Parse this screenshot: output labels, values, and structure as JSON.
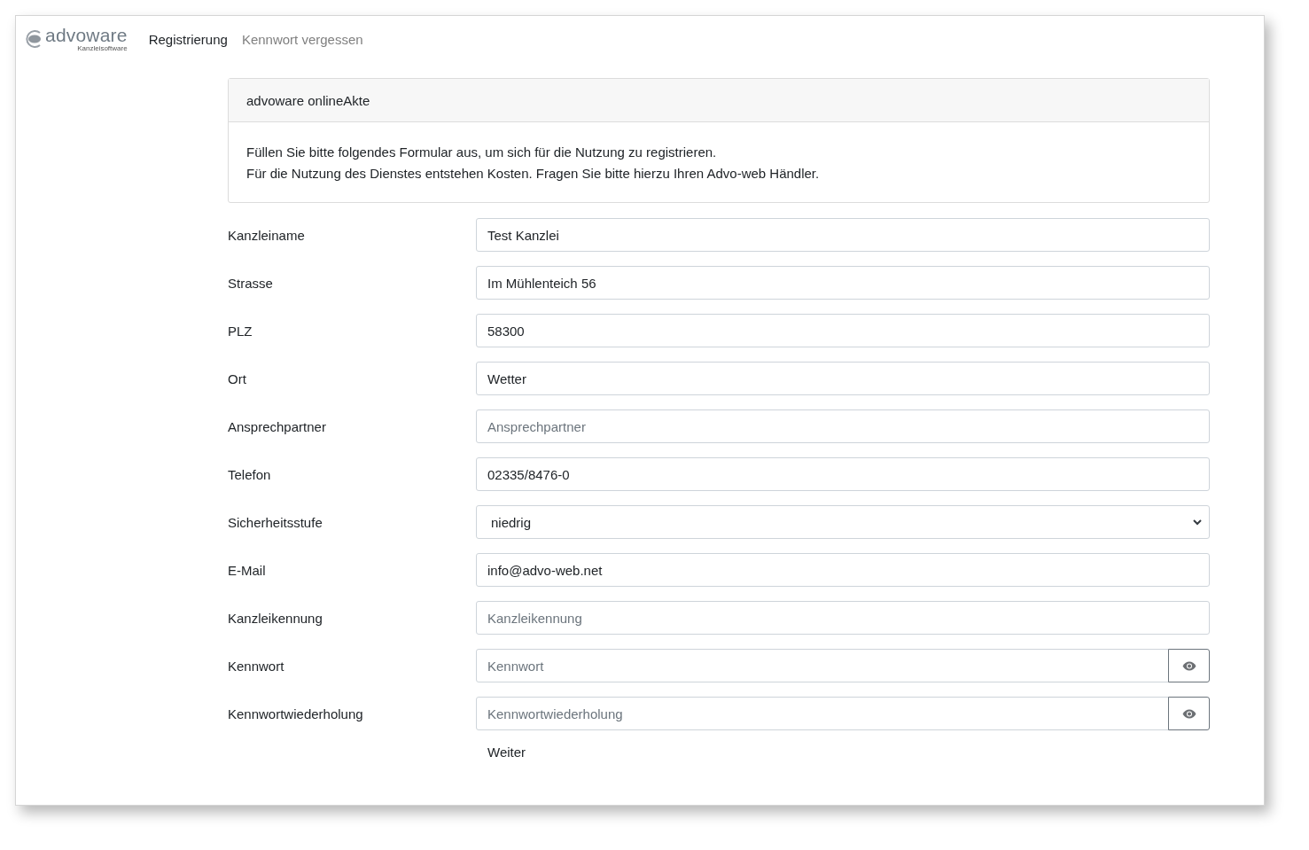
{
  "logo": {
    "name": "advoware",
    "tagline": "Kanzleisoftware"
  },
  "nav": [
    {
      "label": "Registrierung",
      "selected": true
    },
    {
      "label": "Kennwort vergessen",
      "selected": false
    }
  ],
  "card": {
    "title": "advoware onlineAkte",
    "lines": [
      "Füllen Sie bitte folgendes Formular aus, um sich für die Nutzung zu registrieren.",
      "Für die Nutzung des Dienstes entstehen Kosten. Fragen Sie bitte hierzu Ihren Advo-web Händler."
    ]
  },
  "fields": [
    {
      "kind": "text",
      "label": "Kanzleiname",
      "value": "Test Kanzlei"
    },
    {
      "kind": "text",
      "label": "Strasse",
      "value": "Im Mühlenteich 56"
    },
    {
      "kind": "text",
      "label": "PLZ",
      "value": "58300"
    },
    {
      "kind": "text",
      "label": "Ort",
      "value": "Wetter"
    },
    {
      "kind": "text",
      "label": "Ansprechpartner",
      "placeholder": "Ansprechpartner"
    },
    {
      "kind": "text",
      "label": "Telefon",
      "value": "02335/8476-0"
    },
    {
      "kind": "select",
      "label": "Sicherheitsstufe",
      "value": "niedrig"
    },
    {
      "kind": "text",
      "label": "E-Mail",
      "value": "info@advo-web.net"
    },
    {
      "kind": "text",
      "label": "Kanzleikennung",
      "placeholder": "Kanzleikennung"
    },
    {
      "kind": "password",
      "label": "Kennwort",
      "placeholder": "Kennwort"
    },
    {
      "kind": "password",
      "label": "Kennwortwiederholung",
      "placeholder": "Kennwortwiederholung"
    }
  ],
  "submit": "Weiter"
}
